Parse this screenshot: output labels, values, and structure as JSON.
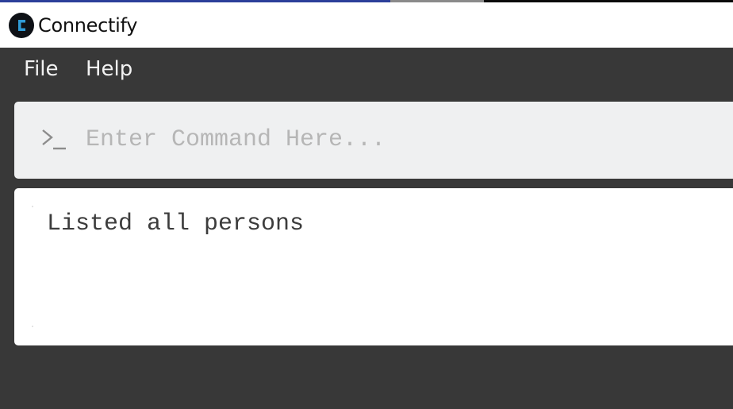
{
  "app": {
    "title": "Connectify",
    "logo_icon": "connectify-logo-icon",
    "accent_color": "#2f9bd6"
  },
  "menu": {
    "items": [
      {
        "label": "File"
      },
      {
        "label": "Help"
      }
    ]
  },
  "command": {
    "prompt_icon": "terminal-prompt-icon",
    "placeholder": "Enter Command Here...",
    "value": ""
  },
  "result": {
    "message": "Listed all persons"
  },
  "colors": {
    "window_background": "#383838",
    "titlebar_background": "#ffffff",
    "command_box_background": "#eff0f1",
    "result_box_background": "#ffffff",
    "menu_text": "#f2f2f2",
    "placeholder_text": "#b6b6b6"
  }
}
